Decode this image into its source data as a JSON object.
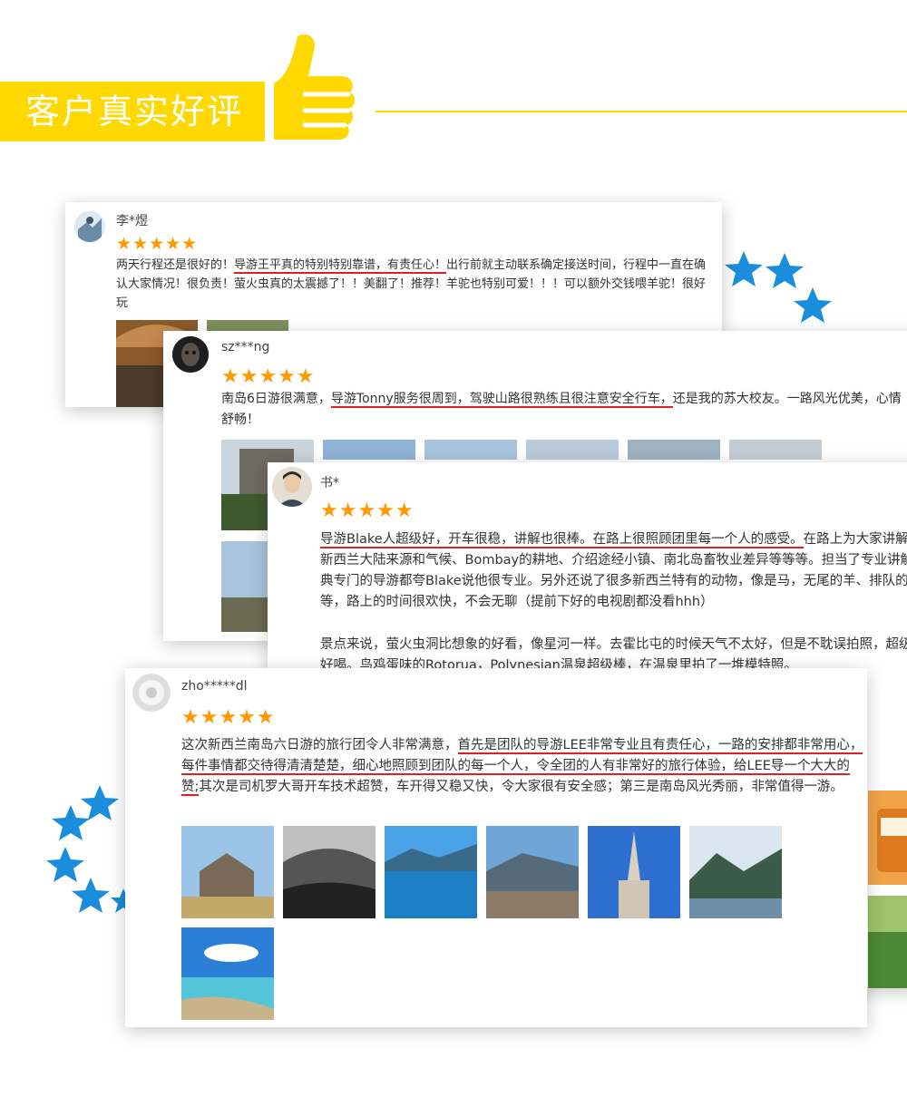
{
  "header": {
    "title": "客户真实好评",
    "icon": "thumbs-up-icon",
    "accent_color": "#ffd800",
    "star_color": "#1a8ddc"
  },
  "reviews": [
    {
      "user": "李*煜",
      "rating": 5,
      "stars": "★★★★★",
      "text_before": "两天行程还是很好的！",
      "highlight": "导游王平真的特别特别靠谱，有责任心！",
      "text_after": "出行前就主动联系确定接送时间，行程中一直在确认大家情况！很负责！萤火虫真的太震撼了！！美翻了！推荐！羊驼也特别可爱！！！可以额外交钱喂羊驼！很好玩"
    },
    {
      "user": "sz***ng",
      "rating": 5,
      "stars": "★★★★★",
      "text_before": "南岛6日游很满意，",
      "highlight": "导游Tonny服务很周到，驾驶山路很熟练且很注意安全行车，",
      "text_after": "还是我的苏大校友。一路风光优美，心情舒畅！"
    },
    {
      "user": "书*",
      "rating": 5,
      "stars": "★★★★★",
      "text_before": "",
      "highlight": "导游Blake人超级好，开车很稳，讲解也很棒。在路上很照顾团里每一个人的感受。",
      "text_after": "在路上为大家讲解了很多内容，像是新西兰大陆来源和气候、Bombay的耕地、介绍途经小镇、南北岛畜牧业差异等等等。担当了专业讲解员的身份，连经典专门的导游都夸Blake说他很专业。另外还说了很多新西兰特有的动物，像是马，无尾的羊、排队的牛、飞机赶鹿等等等，路上的时间很欢快，不会无聊（提前下好的电视剧都没看hhh）",
      "text_extra": "景点来说，萤火虫洞比想象的好看，像星河一样。去霍比屯的时候天气不太好，但是不耽误拍照，超级好看。苹果啤酒很好喝。鸟鸡蛋味的Rotorua，Polynesian温泉超级棒，在温泉里拍了一堆模特照。"
    },
    {
      "user": "zho*****dl",
      "rating": 5,
      "stars": "★★★★★",
      "text_before": "这次新西兰南岛六日游的旅行团令人非常满意，",
      "highlight": "首先是团队的导游LEE非常专业且有责任心，一路的安排都非常用心，每件事情都交待得清清楚楚，细心地照顾到团队的每一个人，令全团的人有非常好的旅行体验，给LEE导一个大大的赞;",
      "text_after": "其次是司机罗大哥开车技术超赞，车开得又稳又快，令大家很有安全感；第三是南岛风光秀丽，非常值得一游。"
    }
  ]
}
